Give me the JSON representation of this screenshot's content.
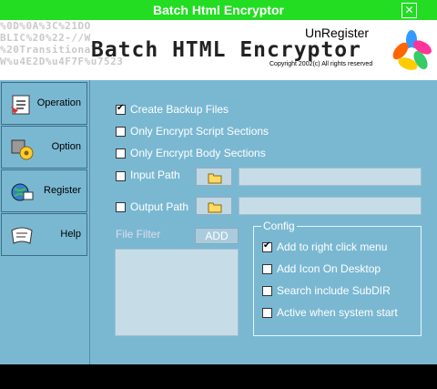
{
  "window": {
    "title": "Batch Html Encryptor",
    "close_glyph": "✕"
  },
  "banner": {
    "code_lines": [
      "%0D%0A%3C%21DO",
      "BLIC%20%22-//W",
      "%20Transitional",
      "W%u4E2D%u4F7F%u7523"
    ],
    "brand": "Batch HTML Encryptor",
    "status": "UnRegister",
    "copyright": "Copyright 2002(c) All rights reserved"
  },
  "sidebar": {
    "items": [
      {
        "label": "Operation",
        "icon": "operation-icon"
      },
      {
        "label": "Option",
        "icon": "option-gear-icon"
      },
      {
        "label": "Register",
        "icon": "register-globe-icon"
      },
      {
        "label": "Help",
        "icon": "help-scroll-icon"
      }
    ]
  },
  "options": {
    "create_backup": {
      "label": "Create Backup Files",
      "checked": true
    },
    "encrypt_script": {
      "label": "Only Encrypt Script Sections",
      "checked": false
    },
    "encrypt_body": {
      "label": "Only Encrypt Body Sections",
      "checked": false
    },
    "input_path": {
      "label": "Input Path",
      "checked": false,
      "value": ""
    },
    "output_path": {
      "label": "Output Path",
      "checked": false,
      "value": ""
    }
  },
  "filter": {
    "label": "File Filter",
    "add_label": "ADD"
  },
  "config": {
    "legend": "Config",
    "items": [
      {
        "label": "Add to right click menu",
        "checked": true
      },
      {
        "label": "Add Icon On Desktop",
        "checked": false
      },
      {
        "label": "Search include SubDIR",
        "checked": false
      },
      {
        "label": "Active when system start",
        "checked": false
      }
    ]
  },
  "colors": {
    "title_bar": "#22dd22",
    "panel": "#7ab8d2",
    "option_text": "#ffffff"
  }
}
